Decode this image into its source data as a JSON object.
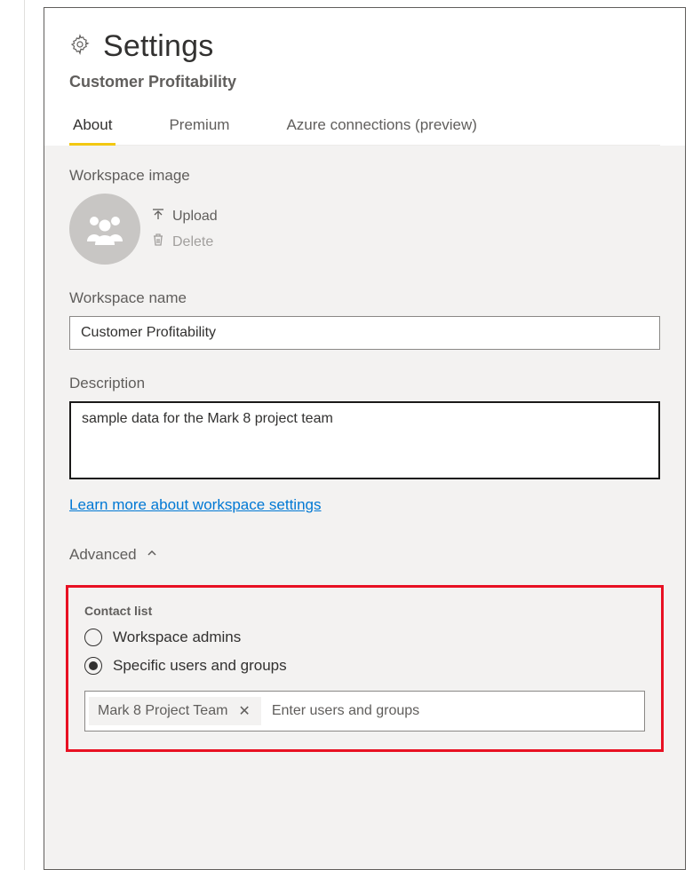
{
  "header": {
    "title": "Settings",
    "subtitle": "Customer Profitability"
  },
  "tabs": {
    "about": "About",
    "premium": "Premium",
    "azure": "Azure connections (preview)"
  },
  "workspace_image": {
    "label": "Workspace image",
    "upload": "Upload",
    "delete": "Delete"
  },
  "workspace_name": {
    "label": "Workspace name",
    "value": "Customer Profitability"
  },
  "description": {
    "label": "Description",
    "value": "sample data for the Mark 8 project team"
  },
  "learn_more": "Learn more about workspace settings",
  "advanced": {
    "label": "Advanced"
  },
  "contact_list": {
    "label": "Contact list",
    "option_admins": "Workspace admins",
    "option_specific": "Specific users and groups",
    "chip": "Mark 8 Project Team",
    "placeholder": "Enter users and groups"
  }
}
